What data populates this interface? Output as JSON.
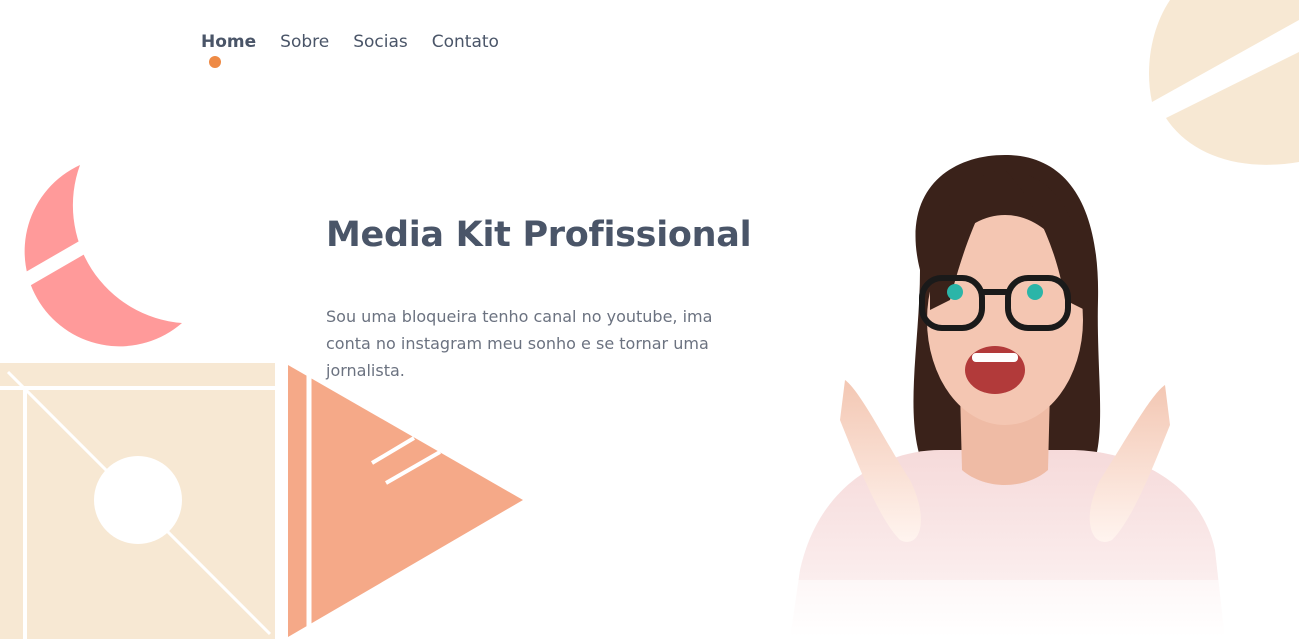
{
  "nav": {
    "items": [
      {
        "label": "Home",
        "active": true
      },
      {
        "label": "Sobre",
        "active": false
      },
      {
        "label": "Socias",
        "active": false
      },
      {
        "label": "Contato",
        "active": false
      }
    ],
    "indicator_color": "#ee8a45"
  },
  "hero": {
    "title": "Media Kit Profissional",
    "description": "Sou uma bloqueira tenho canal no youtube, ima conta no instagram meu sonho e se tornar uma jornalista."
  },
  "colors": {
    "text": "#4a5568",
    "muted_text": "#6b7280",
    "accent_orange": "#ee8a45",
    "shape_pink": "#ff9a9a",
    "shape_cream": "#f7e8d3",
    "shape_salmon": "#f5a988"
  },
  "images": {
    "hero_person": "smiling-woman-with-glasses-photo"
  }
}
